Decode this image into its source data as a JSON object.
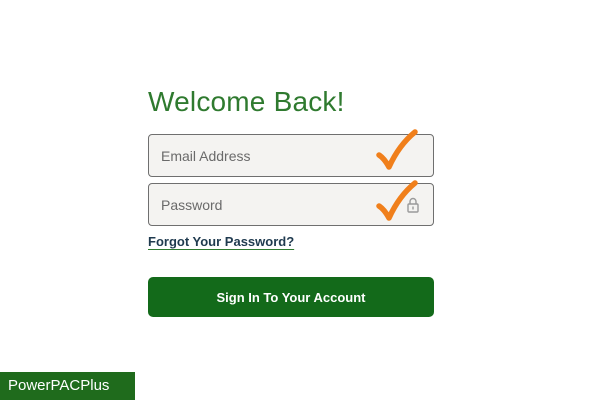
{
  "form": {
    "title": "Welcome Back!",
    "email_placeholder": "Email Address",
    "email_value": "",
    "password_placeholder": "Password",
    "password_value": "",
    "forgot_label": "Forgot Your Password?",
    "signin_label": "Sign In To Your Account"
  },
  "annotations": {
    "check_icon": "checkmark-icon",
    "check_color": "#f07f1b"
  },
  "icons": {
    "password_icon": "lock-icon"
  },
  "brand": {
    "label": "PowerPACPlus"
  },
  "colors": {
    "title": "#2f7a2f",
    "button": "#136a1a",
    "brand_badge": "#1f6b1c"
  }
}
